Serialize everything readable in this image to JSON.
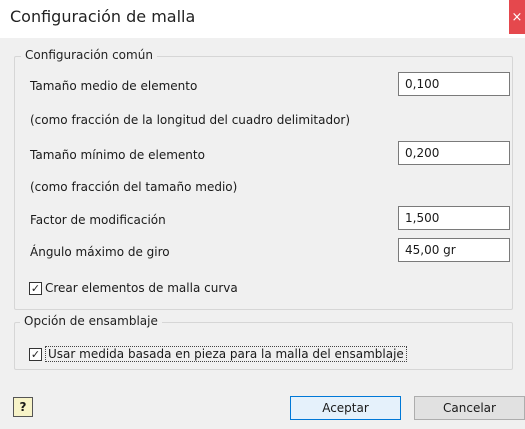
{
  "dialog": {
    "title": "Configuración de malla",
    "close_glyph": "×"
  },
  "common": {
    "legend": "Configuración común",
    "avg_size": {
      "label": "Tamaño medio de elemento",
      "value": "0,100"
    },
    "avg_note": "(como fracción de la longitud del cuadro delimitador)",
    "min_size": {
      "label": "Tamaño mínimo de elemento",
      "value": "0,200"
    },
    "min_note": "(como fracción del tamaño medio)",
    "factor": {
      "label": "Factor de modificación",
      "value": "1,500"
    },
    "angle": {
      "label": "Ángulo máximo de giro",
      "value": "45,00 gr"
    },
    "curved": {
      "label": "Crear elementos de malla curva",
      "checked": true
    }
  },
  "assembly": {
    "legend": "Opción de ensamblaje",
    "part_based": {
      "label": "Usar medida basada en pieza para la malla del ensamblaje",
      "checked": true
    }
  },
  "footer": {
    "help_glyph": "?",
    "ok_label": "Aceptar",
    "cancel_label": "Cancelar"
  },
  "icons": {
    "check": "✓"
  }
}
